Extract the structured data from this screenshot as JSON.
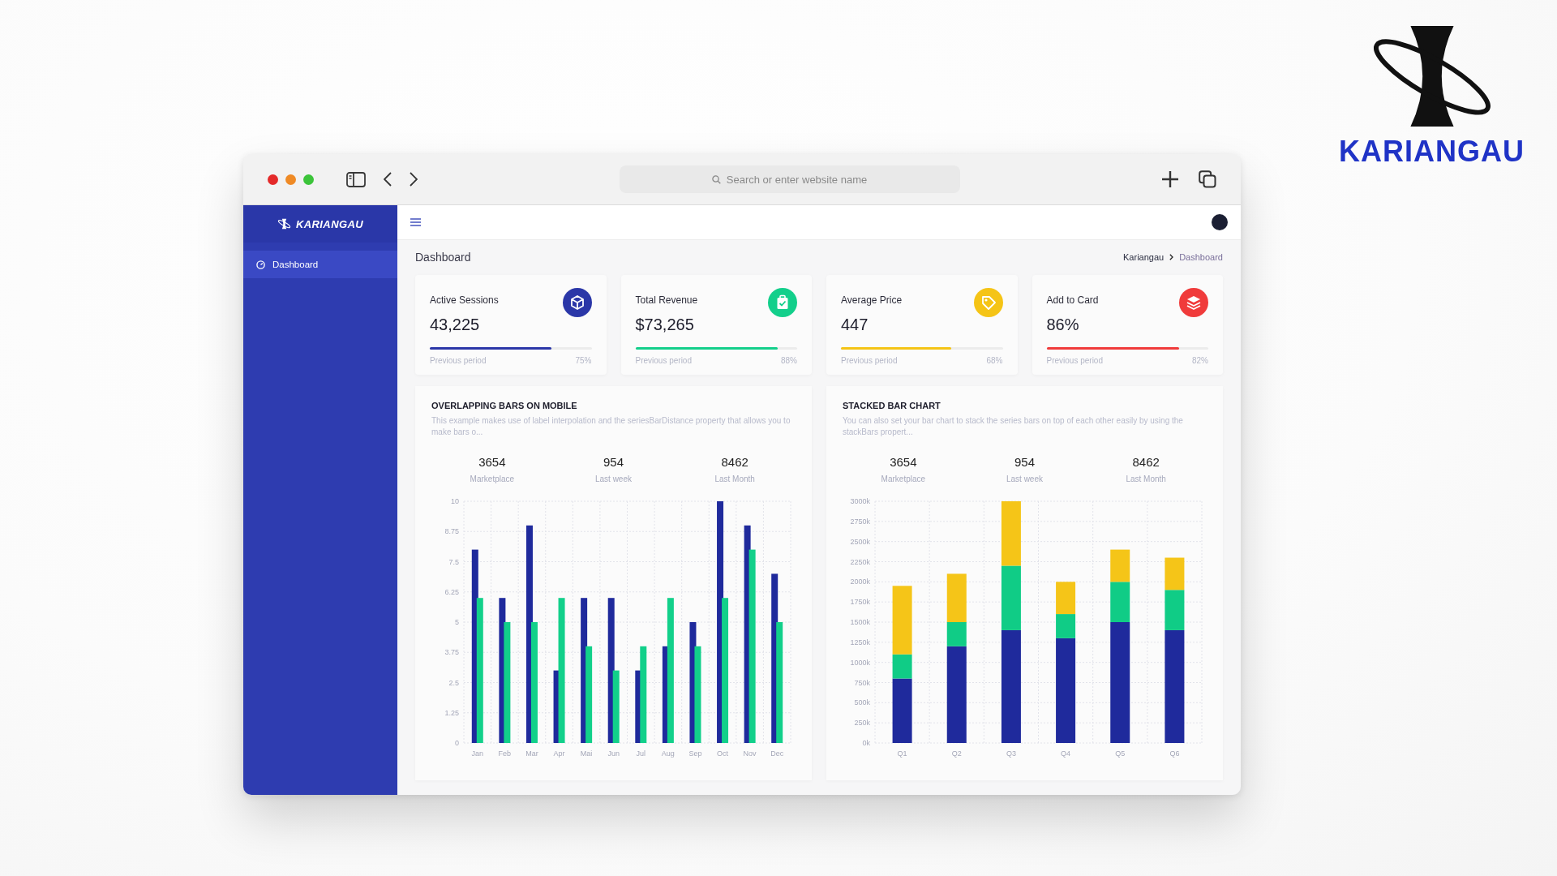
{
  "browser": {
    "address_bar": {
      "placeholder": "Search or enter website name"
    }
  },
  "sidebar": {
    "logo": "KARIANGAU",
    "items": [
      {
        "label": "Dashboard",
        "selected": true
      }
    ]
  },
  "page": {
    "title": "Dashboard",
    "breadcrumb": [
      "Kariangau",
      "Dashboard"
    ]
  },
  "stat_cards": [
    {
      "title": "Active Sessions",
      "value": "43,225",
      "color": "#2b37a8",
      "level": 0.75,
      "caption": "Previous period",
      "percent": "75%"
    },
    {
      "title": "Total Revenue",
      "value": "$73,265",
      "color": "#13cf8b",
      "level": 0.88,
      "caption": "Previous period",
      "percent": "88%"
    },
    {
      "title": "Average Price",
      "value": "447",
      "color": "#f5c416",
      "level": 0.68,
      "caption": "Previous period",
      "percent": "68%"
    },
    {
      "title": "Add to Card",
      "value": "86%",
      "color": "#f03b3b",
      "level": 0.82,
      "caption": "Previous period",
      "percent": "82%"
    }
  ],
  "charts": [
    {
      "title": "OVERLAPPING BARS ON MOBILE",
      "description": "This example makes use of label interpolation and the seriesBarDistance property that allows you to make bars o...",
      "stats": [
        {
          "value": "3654",
          "label": "Marketplace"
        },
        {
          "value": "954",
          "label": "Last week"
        },
        {
          "value": "8462",
          "label": "Last Month"
        }
      ],
      "chart_data": {
        "type": "bar",
        "stacked": false,
        "grid": true,
        "categories": [
          "Jan",
          "Feb",
          "Mar",
          "Apr",
          "Mai",
          "Jun",
          "Jul",
          "Aug",
          "Sep",
          "Oct",
          "Nov",
          "Dec"
        ],
        "series": [
          {
            "color": "#1f2a9c",
            "values": [
              8,
              6,
              9,
              3,
              6,
              6,
              3,
              4,
              5,
              10,
              9,
              7
            ]
          },
          {
            "color": "#12d08a",
            "values": [
              6,
              5,
              5,
              6,
              4,
              3,
              4,
              6,
              4,
              6,
              8,
              5
            ]
          }
        ],
        "ylim": [
          0,
          10
        ],
        "yticks": [
          0,
          1.25,
          2.5,
          3.75,
          5,
          6.25,
          7.5,
          8.75,
          10
        ]
      }
    },
    {
      "title": "STACKED BAR CHART",
      "description": "You can also set your bar chart to stack the series bars on top of each other easily by using the stackBars propert...",
      "stats": [
        {
          "value": "3654",
          "label": "Marketplace"
        },
        {
          "value": "954",
          "label": "Last week"
        },
        {
          "value": "8462",
          "label": "Last Month"
        }
      ],
      "chart_data": {
        "type": "bar",
        "stacked": true,
        "grid": true,
        "categories": [
          "Q1",
          "Q2",
          "Q3",
          "Q4",
          "Q5",
          "Q6"
        ],
        "series": [
          {
            "color": "#1f2a9c",
            "values": [
              800,
              1200,
              1400,
              1300,
              1500,
              1400
            ]
          },
          {
            "color": "#10cc86",
            "values": [
              300,
              300,
              800,
              300,
              500,
              500
            ]
          },
          {
            "color": "#f5c518",
            "values": [
              850,
              600,
              800,
              400,
              400,
              400
            ]
          }
        ],
        "ylim": [
          0,
          3000
        ],
        "yticks": [
          {
            "value": 0,
            "label": "0k"
          },
          {
            "value": 250,
            "label": "250k"
          },
          {
            "value": 500,
            "label": "500k"
          },
          {
            "value": 750,
            "label": "750k"
          },
          {
            "value": 1000,
            "label": "1000k"
          },
          {
            "value": 1250,
            "label": "1250k"
          },
          {
            "value": 1500,
            "label": "1500k"
          },
          {
            "value": 1750,
            "label": "1750k"
          },
          {
            "value": 2000,
            "label": "2000k"
          },
          {
            "value": 2250,
            "label": "2250k"
          },
          {
            "value": 2500,
            "label": "2500k"
          },
          {
            "value": 2750,
            "label": "2750k"
          },
          {
            "value": 3000,
            "label": "3000k"
          }
        ]
      }
    }
  ],
  "brand_logo": {
    "text": "KARIANGAU"
  }
}
